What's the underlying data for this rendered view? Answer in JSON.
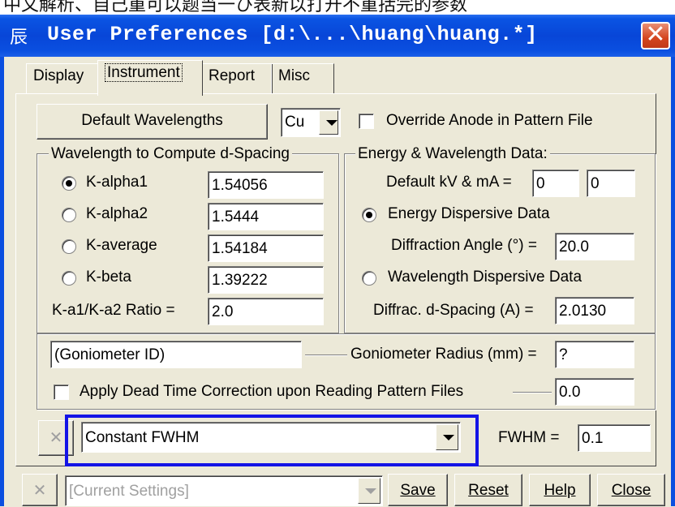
{
  "caption_text": "中文解析、自己重可以题当一ひ表新以打开不重括完的参数",
  "window": {
    "title": "User Preferences [d:\\...\\huang\\huang.*]",
    "close_glyph": "✕"
  },
  "tabs": [
    {
      "label": "Display",
      "active": false
    },
    {
      "label": "Instrument",
      "active": true
    },
    {
      "label": "Report",
      "active": false
    },
    {
      "label": "Misc",
      "active": false
    }
  ],
  "top_row": {
    "default_wavelengths_label": "Default Wavelengths",
    "anode_value": "Cu",
    "override_label": "Override Anode in Pattern File",
    "override_checked": false
  },
  "wavelength_group": {
    "legend": "Wavelength to Compute d-Spacing",
    "options": [
      {
        "label": "K-alpha1",
        "value": "1.54056",
        "selected": true
      },
      {
        "label": "K-alpha2",
        "value": "1.5444",
        "selected": false
      },
      {
        "label": "K-average",
        "value": "1.54184",
        "selected": false
      },
      {
        "label": "K-beta",
        "value": "1.39222",
        "selected": false
      }
    ],
    "ratio_label": "K-a1/K-a2 Ratio =",
    "ratio_value": "2.0"
  },
  "energy_group": {
    "legend": "Energy & Wavelength Data:",
    "kv_ma_label": "Default kV & mA =",
    "kv_value": "0",
    "ma_value": "0",
    "energy_dispersive_label": "Energy Dispersive Data",
    "energy_dispersive_selected": true,
    "diffraction_angle_label": "Diffraction Angle (°) =",
    "diffraction_angle_value": "20.0",
    "wavelength_dispersive_label": "Wavelength Dispersive Data",
    "wavelength_dispersive_selected": false,
    "d_spacing_label": "Diffrac. d-Spacing (A) =",
    "d_spacing_value": "2.0130"
  },
  "goniometer": {
    "id_value": "(Goniometer ID)",
    "radius_label": "Goniometer Radius (mm) =",
    "radius_value": "?",
    "dead_time_label": "Apply Dead Time Correction upon Reading Pattern Files",
    "dead_time_checked": false,
    "dead_time_value": "0.0"
  },
  "fwhm_row": {
    "x_glyph": "✕",
    "mode_value": "Constant FWHM",
    "fwhm_label": "FWHM =",
    "fwhm_value": "0.1"
  },
  "bottom_bar": {
    "x_glyph": "✕",
    "settings_value": "[Current Settings]",
    "save_label": "Save",
    "reset_label": "Reset",
    "help_label": "Help",
    "close_label": "Close"
  },
  "colors": {
    "titlebar": "#0846d8",
    "dialog_bg": "#ECE9D8",
    "highlight": "#1414e6",
    "close_button": "#d4461f"
  }
}
